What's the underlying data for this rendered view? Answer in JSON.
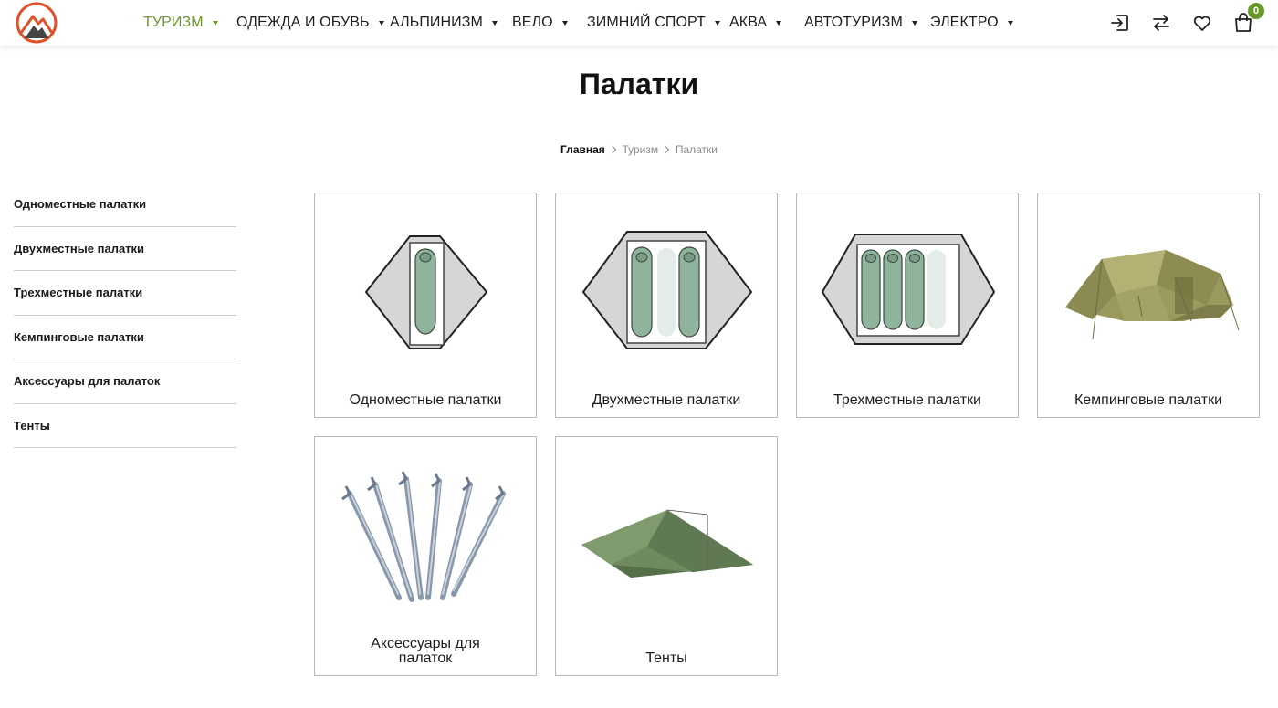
{
  "header": {
    "nav": [
      {
        "label": "ТУРИЗМ",
        "active": true
      },
      {
        "label": "ОДЕЖДА И ОБУВЬ",
        "active": false
      },
      {
        "label": "АЛЬПИНИЗМ",
        "active": false
      },
      {
        "label": "ВЕЛО",
        "active": false
      },
      {
        "label": "ЗИМНИЙ СПОРТ",
        "active": false
      },
      {
        "label": "АКВА",
        "active": false
      },
      {
        "label": "АВТОТУРИЗМ",
        "active": false
      },
      {
        "label": "ЭЛЕКТРО",
        "active": false
      }
    ],
    "icons": [
      "login-icon",
      "compare-icon",
      "heart-icon",
      "cart-icon"
    ],
    "cart_count": "0",
    "accent_color": "#6a9a2a",
    "logo_color": "#e0512a"
  },
  "page": {
    "title": "Палатки"
  },
  "breadcrumb": {
    "home": "Главная",
    "section": "Туризм",
    "current": "Палатки"
  },
  "sidebar": {
    "items": [
      "Одноместные палатки",
      "Двухместные палатки",
      "Трехместные палатки",
      "Кемпинговые палатки",
      "Аксессуары для палаток",
      "Тенты"
    ]
  },
  "categories": [
    {
      "label": "Одноместные палатки",
      "image": "one-person-tent-icon"
    },
    {
      "label": "Двухместные палатки",
      "image": "two-person-tent-icon"
    },
    {
      "label": "Трехместные палатки",
      "image": "three-person-tent-icon"
    },
    {
      "label": "Кемпинговые палатки",
      "image": "camping-tent-photo"
    },
    {
      "label": "Аксессуары для палаток",
      "image": "tent-pegs-photo"
    },
    {
      "label": "Тенты",
      "image": "tarp-photo"
    }
  ]
}
